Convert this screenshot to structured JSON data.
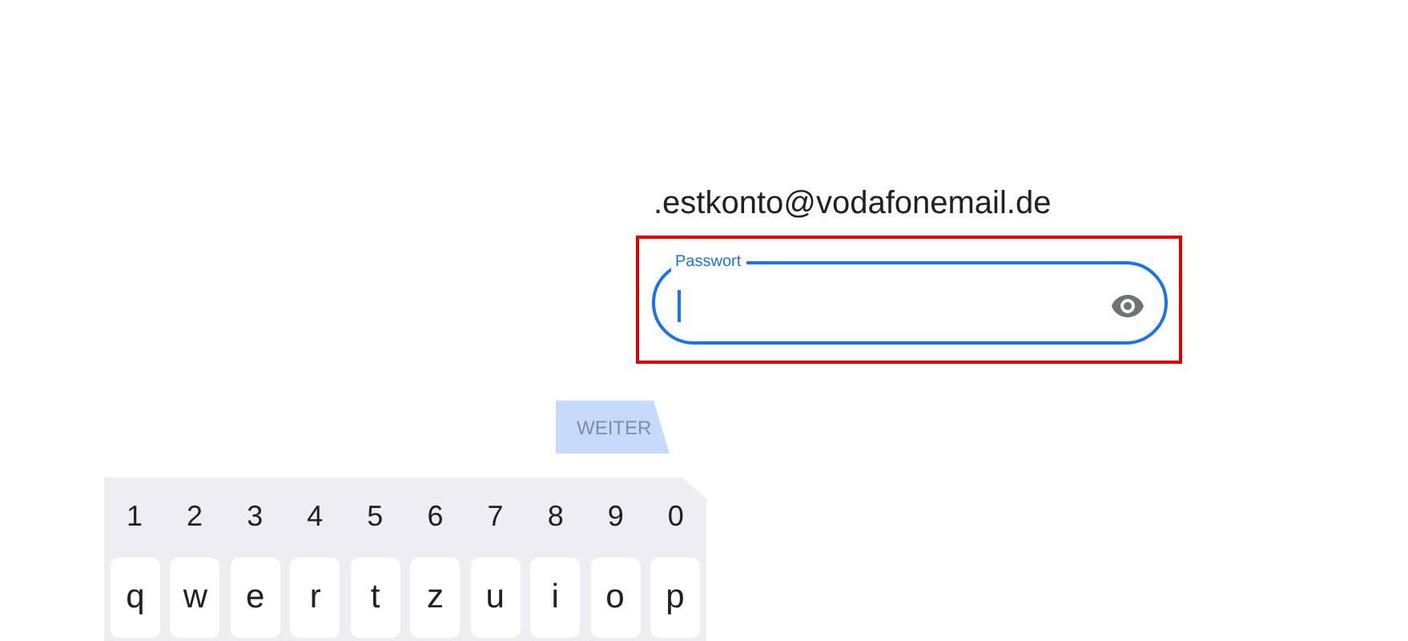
{
  "account_email": ".estkonto@vodafonemail.de",
  "password_field": {
    "label": "Passwort",
    "focused": true,
    "highlighted": true
  },
  "next_button": {
    "label": "WEITER",
    "disabled": true
  },
  "keyboard": {
    "number_row": [
      "1",
      "2",
      "3",
      "4",
      "5",
      "6",
      "7",
      "8",
      "9",
      "0"
    ],
    "letter_row": [
      "q",
      "w",
      "e",
      "r",
      "t",
      "z",
      "u",
      "i",
      "o",
      "p"
    ]
  }
}
